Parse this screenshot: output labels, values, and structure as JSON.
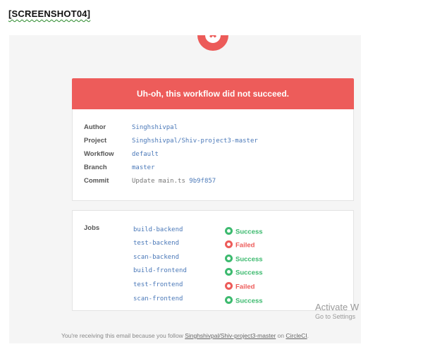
{
  "doc_label": "[SCREENSHOT04]",
  "email": {
    "banner_title": "Uh-oh, this workflow did not succeed.",
    "details": [
      {
        "label": "Author",
        "value": "Singhshivpal",
        "extra": ""
      },
      {
        "label": "Project",
        "value": "Singhshivpal/Shiv-project3-master",
        "extra": ""
      },
      {
        "label": "Workflow",
        "value": "default",
        "extra": ""
      },
      {
        "label": "Branch",
        "value": "master",
        "extra": ""
      },
      {
        "label": "Commit",
        "value": "9b9f857",
        "extra": "Update main.ts"
      }
    ],
    "jobs_label": "Jobs",
    "jobs": [
      {
        "name": "build-backend",
        "status": "Success"
      },
      {
        "name": "test-backend",
        "status": "Failed"
      },
      {
        "name": "scan-backend",
        "status": "Success"
      },
      {
        "name": "build-frontend",
        "status": "Success"
      },
      {
        "name": "test-frontend",
        "status": "Failed"
      },
      {
        "name": "scan-frontend",
        "status": "Success"
      }
    ],
    "footer": {
      "prefix": "You're receiving this email because you follow",
      "link": "Singhshivpal/Shiv-project3-master",
      "middle": "on",
      "circle_link": "CircleCI",
      "suffix": "."
    }
  },
  "watermark": {
    "title": "Activate W",
    "subtitle": "Go to Settings"
  },
  "colors": {
    "failure": "#ed5c5a",
    "success": "#3dba6f",
    "link": "#4a78b8"
  },
  "icons": {
    "status": "x-circle-icon",
    "success": "check-circle-icon",
    "failed": "x-circle-icon"
  }
}
